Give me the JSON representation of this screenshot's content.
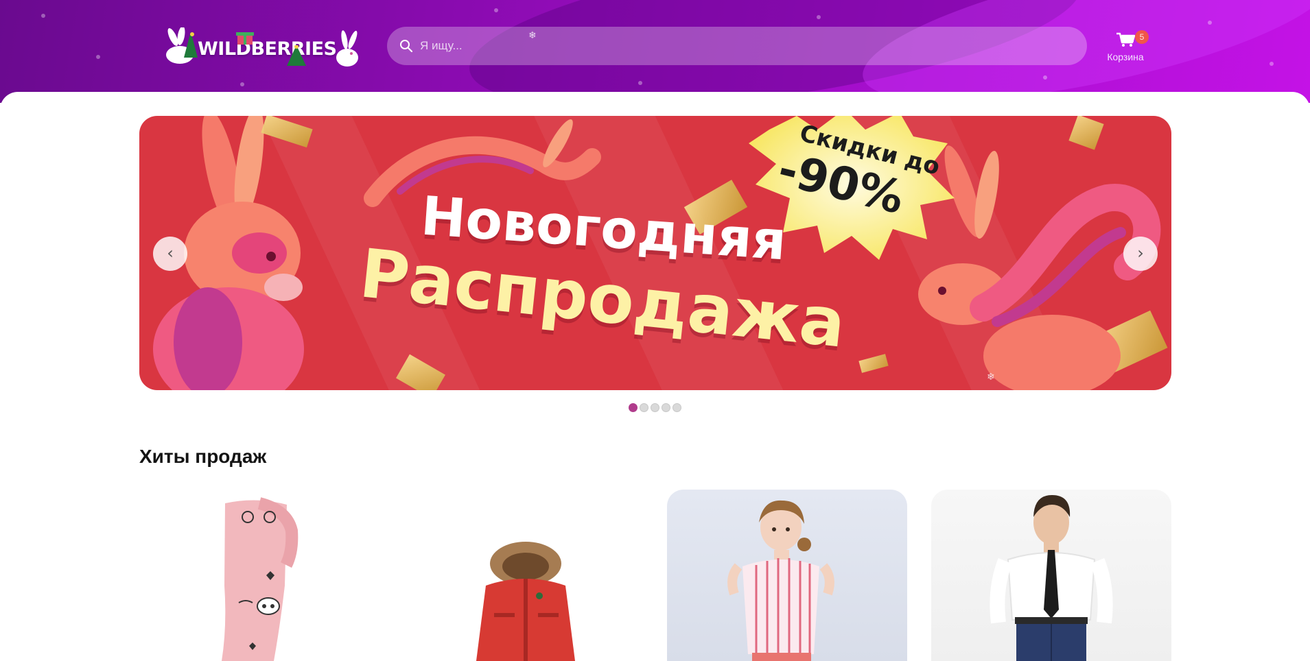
{
  "header": {
    "logo_text": "WILDBERRIES",
    "search": {
      "placeholder": "Я ищу..."
    },
    "cart": {
      "label": "Корзина",
      "count": "5"
    }
  },
  "banner": {
    "title_line1": "Новогодняя",
    "title_line2": "Распродажа",
    "discount_label": "Скидки до",
    "discount_value": "-90%",
    "prev_label": "‹",
    "next_label": "›",
    "slide_count": 5,
    "active_slide": 1
  },
  "section": {
    "title": "Хиты продаж"
  },
  "products": [
    {
      "kind": "колготки"
    },
    {
      "kind": "куртка"
    },
    {
      "kind": "блузка"
    },
    {
      "kind": "рубашка"
    }
  ],
  "colors": {
    "header_start": "#6a0a8f",
    "header_end": "#c412e6",
    "banner_bg": "#d93641",
    "badge": "#f0564a",
    "active_dot": "#b03c8c"
  }
}
